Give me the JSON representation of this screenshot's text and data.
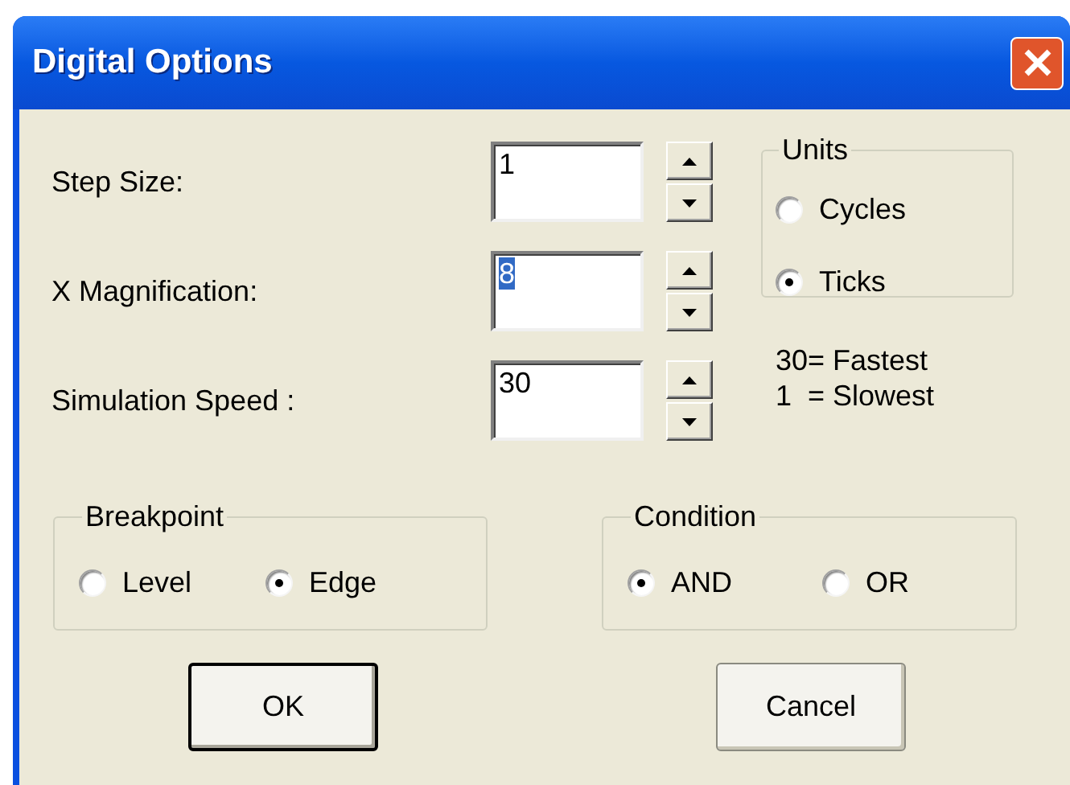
{
  "window": {
    "title": "Digital Options"
  },
  "fields": [
    {
      "label": "Step Size:",
      "value": "1",
      "selected": false
    },
    {
      "label": "X Magnification:",
      "value": "8",
      "selected": true
    },
    {
      "label": "Simulation Speed :",
      "value": "30",
      "selected": false
    }
  ],
  "units": {
    "title": "Units",
    "options": [
      {
        "label": "Cycles",
        "selected": false
      },
      {
        "label": "Ticks",
        "selected": true
      }
    ]
  },
  "speed_hint": [
    "30= Fastest",
    "1  = Slowest"
  ],
  "groups": [
    {
      "title": "Breakpoint",
      "options": [
        {
          "label": "Level",
          "selected": false
        },
        {
          "label": "Edge",
          "selected": true
        }
      ]
    },
    {
      "title": "Condition",
      "options": [
        {
          "label": "AND",
          "selected": true
        },
        {
          "label": "OR",
          "selected": false
        }
      ]
    }
  ],
  "buttons": [
    {
      "label": "OK",
      "default": true
    },
    {
      "label": "Cancel",
      "default": false
    }
  ]
}
